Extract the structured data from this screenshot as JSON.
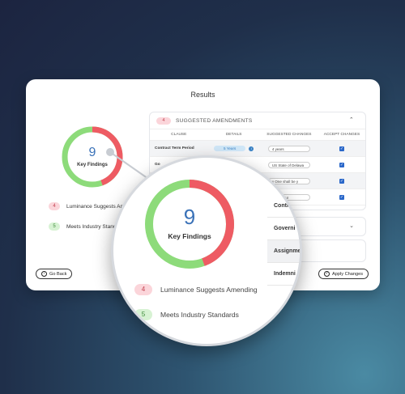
{
  "results": {
    "title": "Results",
    "key_findings": {
      "count": "9",
      "label": "Key Findings",
      "amend_fraction": 0.444
    },
    "legend": [
      {
        "count": "4",
        "label": "Luminance Suggests Amending",
        "color": "red"
      },
      {
        "count": "5",
        "label": "Meets Industry Standards",
        "color": "green"
      }
    ],
    "amendments": {
      "count": "4",
      "header": "SUGGESTED AMENDMENTS",
      "columns": [
        "CLAUSE",
        "DETAILS",
        "SUGGESTED CHANGES",
        "ACCEPT CHANGES"
      ],
      "rows": [
        {
          "clause": "Contract Term Period",
          "details": "5 Years",
          "change": "4 years"
        },
        {
          "clause": "Go",
          "details": "",
          "change": "US State of Delawa"
        },
        {
          "clause": "",
          "details": "",
          "change": "y One shall be y"
        },
        {
          "clause": "",
          "details": "",
          "change": "Liability ur"
        }
      ]
    },
    "side_rows": [
      "Contr",
      "Governi",
      "Assignme",
      "Indemni"
    ],
    "buttons": {
      "go_back": "Go Back",
      "apply": "Apply Changes"
    }
  },
  "colors": {
    "red": "#ee5b63",
    "green": "#8ddb7a",
    "number": "#3b72b8"
  }
}
